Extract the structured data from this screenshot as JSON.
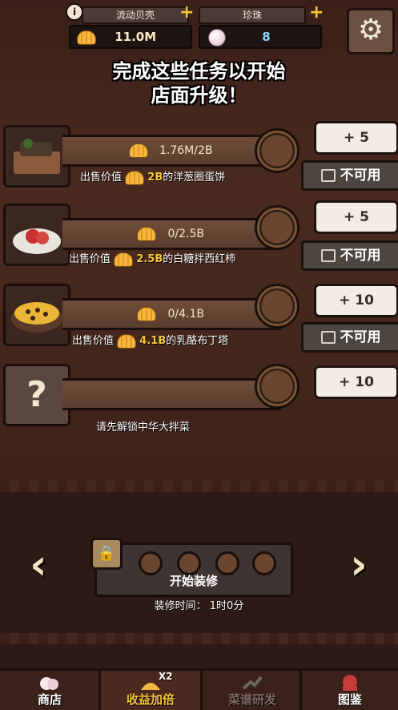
{
  "topbar": {
    "shells_label": "流动贝壳",
    "shells_value": "11.0M",
    "pearls_label": "珍珠",
    "pearls_value": "8"
  },
  "title_line1": "完成这些任务以开始",
  "title_line2": "店面升级！",
  "tasks": [
    {
      "progress": "1.76M/2B",
      "desc_prefix": "出售价值",
      "desc_amount": "2B",
      "desc_suffix": "的洋葱圈蛋饼",
      "reward": "+ 5",
      "status": "不可用"
    },
    {
      "progress": "0/2.5B",
      "desc_prefix": "出售价值",
      "desc_amount": "2.5B",
      "desc_suffix": "的白糖拌西红柿",
      "reward": "+ 5",
      "status": "不可用"
    },
    {
      "progress": "0/4.1B",
      "desc_prefix": "出售价值",
      "desc_amount": "4.1B",
      "desc_suffix": "的乳酪布丁塔",
      "reward": "+ 10",
      "status": "不可用"
    },
    {
      "desc": "请先解锁中华大拌菜",
      "reward": "+ 10",
      "icon_symbol": "?"
    }
  ],
  "renovation": {
    "button_label": "开始装修",
    "time_text": "装修时间： 1时0分"
  },
  "nav": {
    "shop": "商店",
    "double_income": "收益加倍",
    "double_badge": "X2",
    "recipe_research": "菜谱研发",
    "catalog": "图鉴"
  },
  "colors": {
    "accent_gold": "#f6c53a",
    "bar_brown": "#6e4d3a",
    "card_light": "#f3ece2"
  }
}
